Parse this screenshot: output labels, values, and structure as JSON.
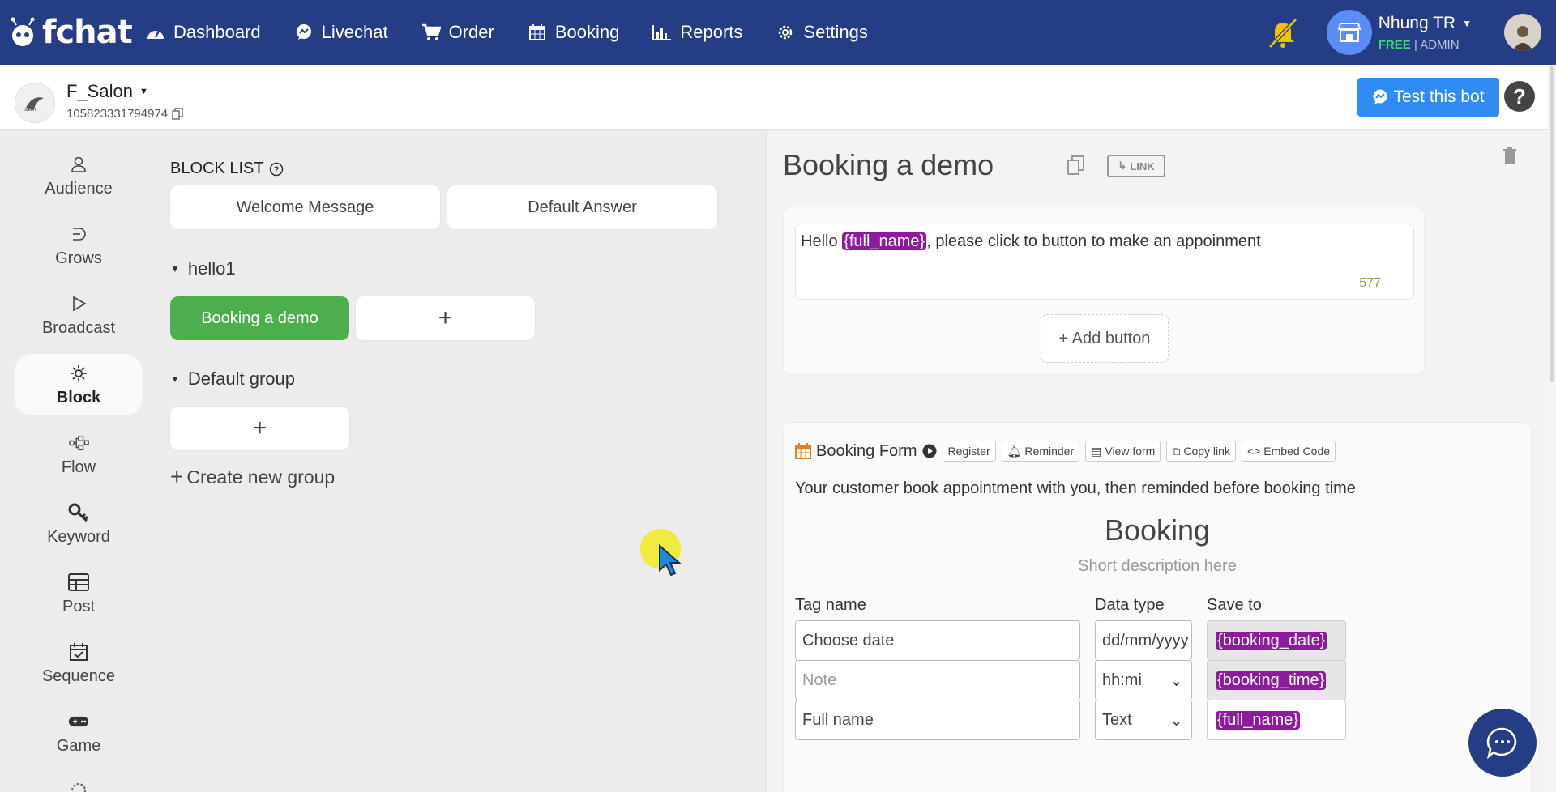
{
  "brand": {
    "name": "fchat"
  },
  "nav": [
    {
      "label": "Dashboard",
      "icon": "dashboard-icon"
    },
    {
      "label": "Livechat",
      "icon": "chat-icon"
    },
    {
      "label": "Order",
      "icon": "cart-icon"
    },
    {
      "label": "Booking",
      "icon": "calendar-icon"
    },
    {
      "label": "Reports",
      "icon": "bar-chart-icon"
    },
    {
      "label": "Settings",
      "icon": "gear-icon"
    }
  ],
  "user": {
    "name": "Nhung TR",
    "plan": "FREE",
    "role": "ADMIN"
  },
  "page": {
    "name": "F_Salon",
    "id": "105823331794974",
    "test_bot_label": "Test this bot",
    "help_label": "?"
  },
  "sidebar": [
    {
      "label": "Audience",
      "icon": "person-icon"
    },
    {
      "label": "Grows",
      "icon": "grows-icon"
    },
    {
      "label": "Broadcast",
      "icon": "play-icon"
    },
    {
      "label": "Block",
      "icon": "block-icon"
    },
    {
      "label": "Flow",
      "icon": "flow-icon"
    },
    {
      "label": "Keyword",
      "icon": "key-icon"
    },
    {
      "label": "Post",
      "icon": "post-icon"
    },
    {
      "label": "Sequence",
      "icon": "sequence-icon"
    },
    {
      "label": "Game",
      "icon": "gamepad-icon"
    }
  ],
  "blocklist": {
    "title": "BLOCK LIST",
    "welcome": "Welcome Message",
    "default_answer": "Default Answer",
    "groups": [
      {
        "name": "hello1",
        "blocks": [
          "Booking a demo"
        ]
      },
      {
        "name": "Default group",
        "blocks": []
      }
    ],
    "add_symbol": "+",
    "create_group": "Create new group"
  },
  "editor": {
    "title": "Booking a demo",
    "link_label": "LINK",
    "message": {
      "prefix": "Hello ",
      "tag": "{full_name}",
      "suffix": ", please click to button to make an appoinment",
      "count": "577"
    },
    "add_button": "+ Add button",
    "form": {
      "label": "Booking Form",
      "actions": [
        "Register",
        "Reminder",
        "View form",
        "Copy link",
        "Embed Code"
      ],
      "description": "Your customer book appointment with you, then reminded before booking time",
      "title": "Booking",
      "subtitle": "Short description here",
      "columns": {
        "tag": "Tag name",
        "type": "Data type",
        "save": "Save to"
      },
      "rows": [
        {
          "tag": "Choose date",
          "tag_placeholder": false,
          "type": "dd/mm/yyyy",
          "save": "{booking_date}"
        },
        {
          "tag": "Note",
          "tag_placeholder": true,
          "type": "hh:mi",
          "save": "{booking_time}"
        },
        {
          "tag": "Full name",
          "tag_placeholder": false,
          "type": "Text",
          "save": "{full_name}"
        }
      ]
    }
  },
  "colors": {
    "topbar": "#253d84",
    "accent": "#2f8cf5",
    "green": "#4cae4c",
    "tag": "#8e1a9e"
  }
}
